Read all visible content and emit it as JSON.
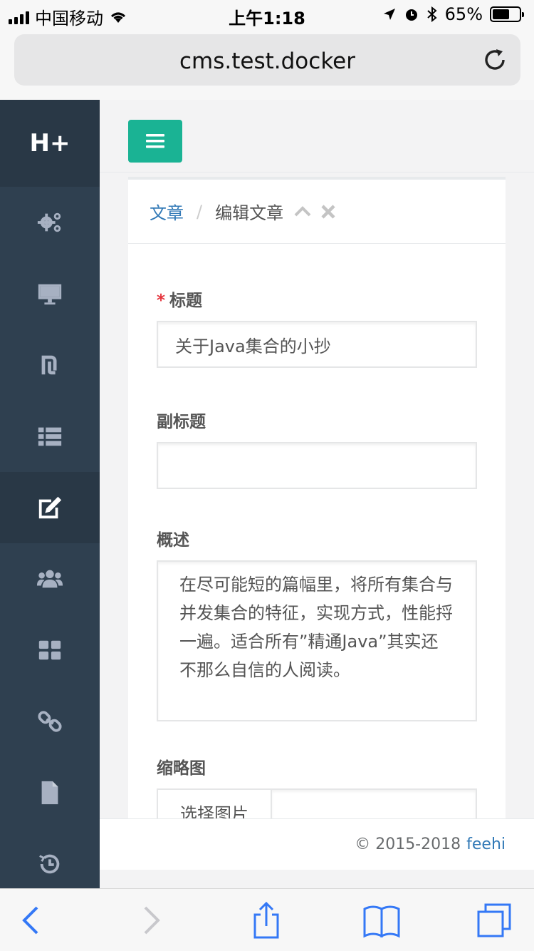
{
  "status_bar": {
    "carrier": "中国移动",
    "time": "上午1:18",
    "battery": "65%",
    "battery_level": 0.65
  },
  "browser": {
    "url": "cms.test.docker"
  },
  "sidebar": {
    "logo": "H+",
    "items": [
      {
        "icon": "gears-icon"
      },
      {
        "icon": "desktop-icon"
      },
      {
        "icon": "shekel-icon"
      },
      {
        "icon": "list-icon"
      },
      {
        "icon": "edit-icon",
        "active": true
      },
      {
        "icon": "users-icon"
      },
      {
        "icon": "th-large-icon"
      },
      {
        "icon": "link-icon"
      },
      {
        "icon": "file-icon"
      },
      {
        "icon": "history-icon"
      }
    ]
  },
  "breadcrumb": {
    "parent": "文章",
    "separator": "/",
    "current": "编辑文章"
  },
  "form": {
    "title_label": "标题",
    "title_required_mark": "*",
    "title_value": "关于Java集合的小抄",
    "subtitle_label": "副标题",
    "subtitle_value": "",
    "summary_label": "概述",
    "summary_value": "在尽可能短的篇幅里，将所有集合与并发集合的特征，实现方式，性能捋一遍。适合所有”精通Java”其实还不那么自信的人阅读。",
    "thumbnail_label": "缩略图",
    "thumbnail_button": "选择图片",
    "thumbnail_value": ""
  },
  "footer": {
    "copyright": "© 2015-2018",
    "link": "feehi"
  },
  "colors": {
    "sidebar_bg": "#2f4050",
    "accent": "#1ab394",
    "link": "#337ab7",
    "required": "#e5343d"
  }
}
